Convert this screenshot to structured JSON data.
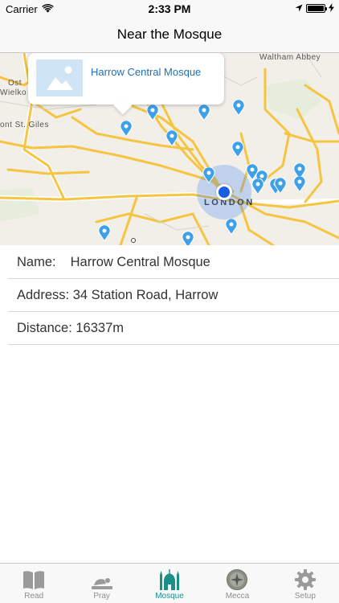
{
  "status_bar": {
    "carrier": "Carrier",
    "time": "2:33 PM"
  },
  "nav": {
    "title": "Near the Mosque"
  },
  "map": {
    "labels": {
      "waltham_abbey": "Waltham Abbey",
      "ost": "Ost",
      "wielko": "Wielko",
      "st_giles": "ont St. Giles",
      "london": "LONDON"
    },
    "callout_title": "Harrow Central Mosque",
    "pin_color": "#3ea0e8"
  },
  "details": {
    "name_label": "Name:",
    "name_value": "Harrow Central Mosque",
    "address": "Address: 34 Station Road, Harrow",
    "distance": "Distance: 16337m"
  },
  "tabs": [
    {
      "label": "Read",
      "icon": "book-icon"
    },
    {
      "label": "Pray",
      "icon": "praying-person-icon"
    },
    {
      "label": "Mosque",
      "icon": "mosque-icon",
      "active": true
    },
    {
      "label": "Mecca",
      "icon": "compass-icon"
    },
    {
      "label": "Setup",
      "icon": "gear-icon"
    }
  ],
  "colors": {
    "accent": "#1a8f8a",
    "link": "#1d6fb8",
    "road": "#f5c542"
  }
}
